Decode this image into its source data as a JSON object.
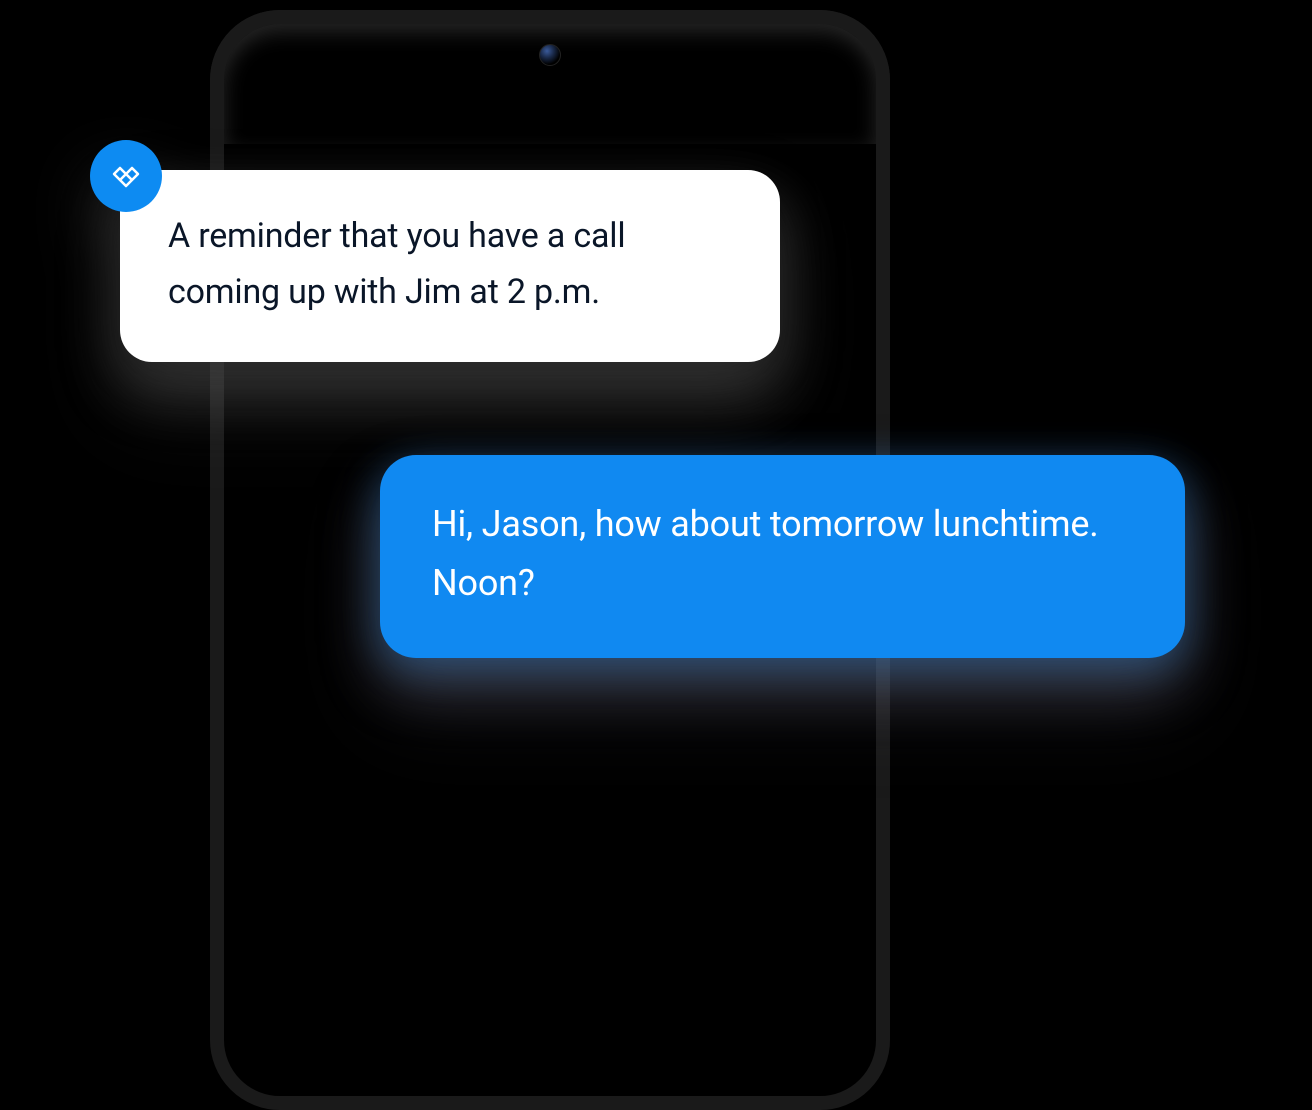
{
  "messages": {
    "assistant_message": "A reminder that you have a call coming up with Jim at 2 p.m.",
    "user_reply": "Hi, Jason, how about tomorrow lunchtime. Noon?"
  },
  "colors": {
    "assistant_bubble_bg": "#ffffff",
    "assistant_bubble_text": "#0a1628",
    "user_bubble_bg": "#1089f1",
    "user_bubble_text": "#ffffff",
    "badge_bg": "#0d8bf2"
  }
}
